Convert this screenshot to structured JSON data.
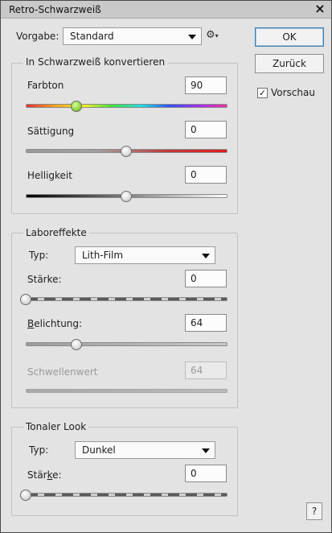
{
  "window": {
    "title": "Retro-Schwarzweiß"
  },
  "preset": {
    "label": "Vorgabe:",
    "value": "Standard"
  },
  "buttons": {
    "ok": "OK",
    "reset": "Zurück",
    "help": "?"
  },
  "preview": {
    "label": "Vorschau",
    "checked": true
  },
  "bw_group": {
    "title": "In Schwarzweiß konvertieren",
    "hue": {
      "label": "Farbton",
      "value": "90"
    },
    "saturation": {
      "label": "Sättigung",
      "value": "0"
    },
    "brightness": {
      "label": "Helligkeit",
      "value": "0"
    }
  },
  "lab_group": {
    "title": "Laboreffekte",
    "type_label": "Typ:",
    "type_value": "Lith-Film",
    "strength": {
      "label": "Stärke:",
      "value": "0"
    },
    "exposure": {
      "label_underlined": "B",
      "label_rest": "elichtung:",
      "value": "64"
    },
    "threshold": {
      "label": "Schwellenwert",
      "value": "64"
    }
  },
  "tonal_group": {
    "title": "Tonaler Look",
    "type_label": "Typ:",
    "type_value": "Dunkel",
    "strength": {
      "label_pre": "Stär",
      "label_underlined": "k",
      "label_post": "e:",
      "value": "0"
    }
  },
  "icons": {
    "close": "×",
    "gear": "⚙",
    "check": "✓"
  }
}
